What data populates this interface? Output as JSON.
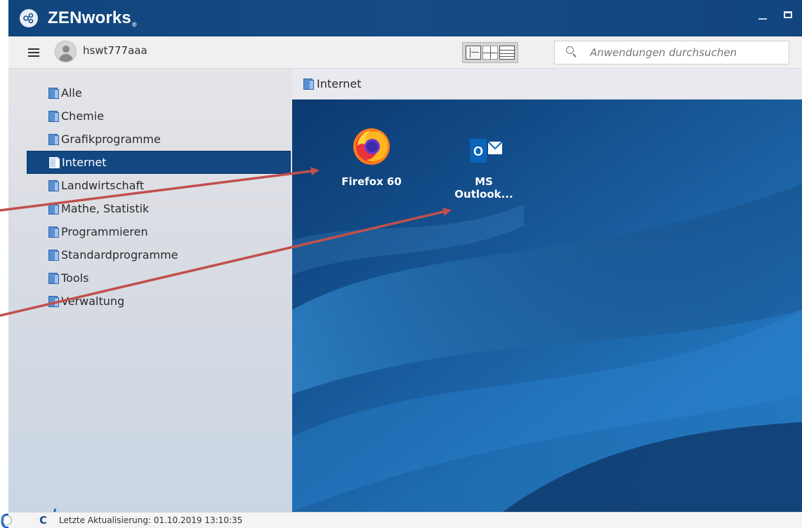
{
  "window": {
    "app_title": "ZENworks",
    "registered_mark": "®"
  },
  "toolbar": {
    "username": "hswt777aaa",
    "search_placeholder": "Anwendungen durchsuchen"
  },
  "sidebar": {
    "items": [
      {
        "label": "Alle",
        "active": false
      },
      {
        "label": "Chemie",
        "active": false
      },
      {
        "label": "Grafikprogramme",
        "active": false
      },
      {
        "label": "Internet",
        "active": true
      },
      {
        "label": "Landwirtschaft",
        "active": false
      },
      {
        "label": "Mathe, Statistik",
        "active": false
      },
      {
        "label": "Programmieren",
        "active": false
      },
      {
        "label": "Standardprogramme",
        "active": false
      },
      {
        "label": "Tools",
        "active": false
      },
      {
        "label": "Verwaltung",
        "active": false
      }
    ]
  },
  "content": {
    "folder_title": "Internet",
    "apps": [
      {
        "label": "Firefox 60",
        "icon": "firefox-icon"
      },
      {
        "label": "MS\nOutlook...",
        "icon": "outlook-icon",
        "line1": "MS",
        "line2": "Outlook..."
      }
    ]
  },
  "slide_overlay": {
    "link_text": "owa/"
  },
  "statusbar": {
    "last_update_text": "Letzte Aktualisierung: 01.10.2019 13:10:35"
  },
  "colors": {
    "titlebar": "#124781",
    "active_item": "#124781",
    "annotation_arrow": "#c0504d",
    "link": "#0b63c9"
  }
}
